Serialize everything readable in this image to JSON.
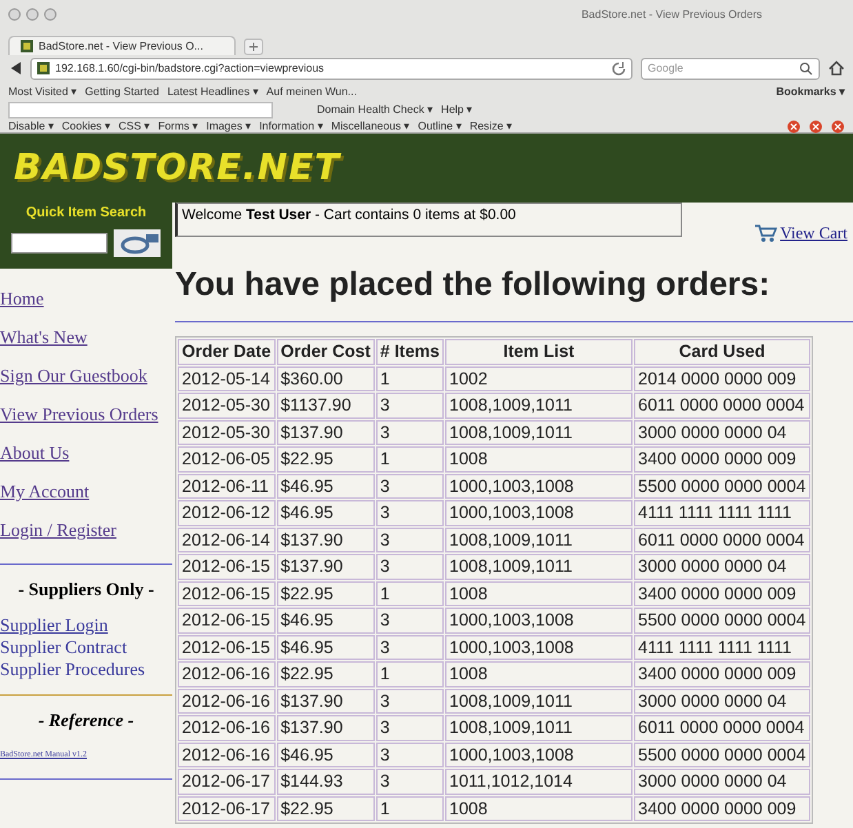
{
  "window": {
    "title": "BadStore.net - View Previous Orders"
  },
  "tabs": [
    {
      "label": "BadStore.net - View Previous O...",
      "selected": true
    }
  ],
  "address_bar": {
    "value": "192.168.1.60/cgi-bin/badstore.cgi?action=viewprevious"
  },
  "search_field": {
    "placeholder": "Google"
  },
  "bookmarks": [
    {
      "label": "Most Visited ▾"
    },
    {
      "label": "Getting Started"
    },
    {
      "label": "Latest Headlines ▾"
    },
    {
      "label": "Auf meinen Wun..."
    }
  ],
  "bookmarks_menu": "Bookmarks ▾",
  "toolbar": {
    "items": [
      "Domain Health Check ▾",
      "Help ▾"
    ]
  },
  "dev_toolbar": {
    "items": [
      "Disable ▾",
      "Cookies ▾",
      "CSS ▾",
      "Forms ▾",
      "Images ▾",
      "Information ▾",
      "Miscellaneous ▾",
      "Outline ▾",
      "Resize ▾"
    ]
  },
  "site": {
    "logo": "BADSTORE.NET",
    "quick_search": {
      "label": "Quick Item Search"
    },
    "welcome": "Welcome **Test User** - Cart contains 0 items at $0.00",
    "view_cart": "View Cart"
  },
  "sidebar": {
    "links": [
      "Home",
      "What's New",
      "Sign Our Guestbook",
      "View Previous Orders",
      "About Us",
      "My Account",
      "Login / Register"
    ],
    "suppliers_heading": "- Suppliers Only -",
    "supplier_links": [
      "Supplier Login",
      "Supplier Contract",
      "Supplier Procedures"
    ],
    "reference_heading": "- Reference -",
    "reference_links": [
      "BadStore.net Manual v1.2"
    ]
  },
  "heading": "You have placed the following orders:",
  "table": {
    "columns": [
      "Order Date",
      "Order Cost",
      "# Items",
      "Item List",
      "Card Used"
    ],
    "rows": [
      [
        "2012-05-14",
        "$360.00",
        "1",
        "1002",
        "2014 0000 0000 009"
      ],
      [
        "2012-05-30",
        "$1137.90",
        "3",
        "1008,1009,1011",
        "6011 0000 0000 0004"
      ],
      [
        "2012-05-30",
        "$137.90",
        "3",
        "1008,1009,1011",
        "3000 0000 0000 04"
      ],
      [
        "2012-06-05",
        "$22.95",
        "1",
        "1008",
        "3400 0000 0000 009"
      ],
      [
        "2012-06-11",
        "$46.95",
        "3",
        "1000,1003,1008",
        "5500 0000 0000 0004"
      ],
      [
        "2012-06-12",
        "$46.95",
        "3",
        "1000,1003,1008",
        "4111 1111 1111 1111"
      ],
      [
        "2012-06-14",
        "$137.90",
        "3",
        "1008,1009,1011",
        "6011 0000 0000 0004"
      ],
      [
        "2012-06-15",
        "$137.90",
        "3",
        "1008,1009,1011",
        "3000 0000 0000 04"
      ],
      [
        "2012-06-15",
        "$22.95",
        "1",
        "1008",
        "3400 0000 0000 009"
      ],
      [
        "2012-06-15",
        "$46.95",
        "3",
        "1000,1003,1008",
        "5500 0000 0000 0004"
      ],
      [
        "2012-06-15",
        "$46.95",
        "3",
        "1000,1003,1008",
        "4111 1111 1111 1111"
      ],
      [
        "2012-06-16",
        "$22.95",
        "1",
        "1008",
        "3400 0000 0000 009"
      ],
      [
        "2012-06-16",
        "$137.90",
        "3",
        "1008,1009,1011",
        "3000 0000 0000 04"
      ],
      [
        "2012-06-16",
        "$137.90",
        "3",
        "1008,1009,1011",
        "6011 0000 0000 0004"
      ],
      [
        "2012-06-16",
        "$46.95",
        "3",
        "1000,1003,1008",
        "5500 0000 0000 0004"
      ],
      [
        "2012-06-17",
        "$144.93",
        "3",
        "1011,1012,1014",
        "3000 0000 0000 04"
      ],
      [
        "2012-06-17",
        "$22.95",
        "1",
        "1008",
        "3400 0000 0000 009"
      ]
    ]
  }
}
